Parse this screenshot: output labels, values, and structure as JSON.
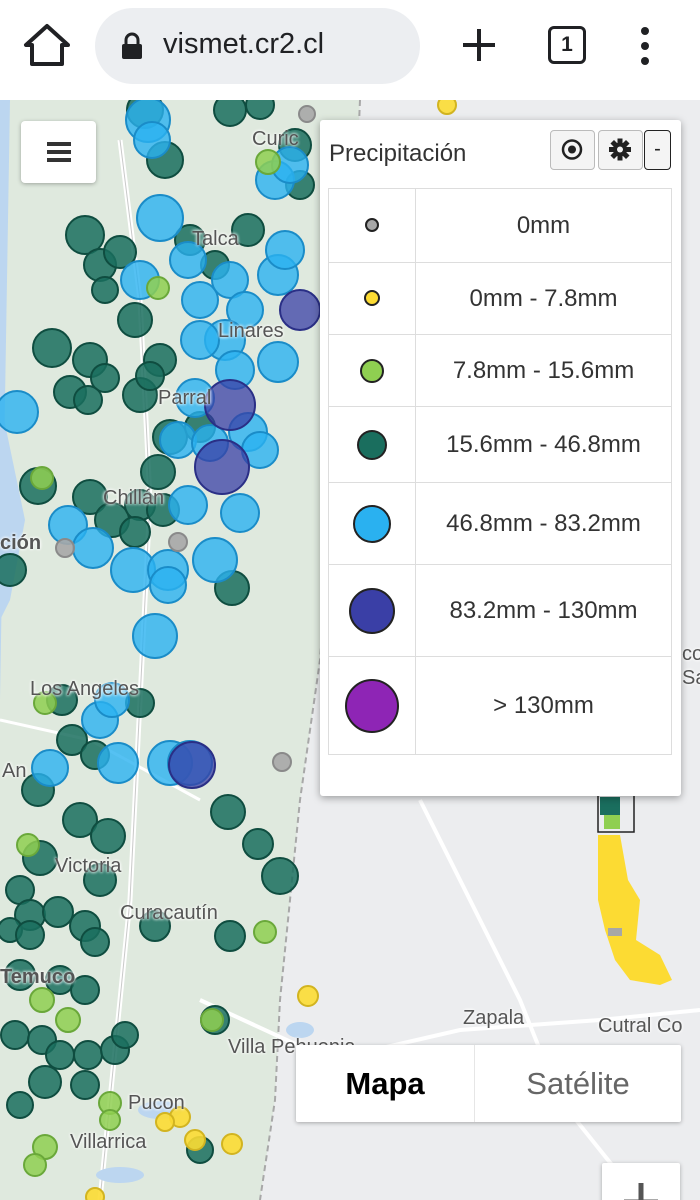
{
  "browser": {
    "url": "vismet.cr2.cl",
    "tab_count": "1"
  },
  "map": {
    "place_labels": [
      {
        "id": "curico",
        "text": "Curic"
      },
      {
        "id": "talca",
        "text": "Talca"
      },
      {
        "id": "linares",
        "text": "Linares"
      },
      {
        "id": "parral",
        "text": "Parral"
      },
      {
        "id": "chillan",
        "text": "Chillán"
      },
      {
        "id": "concepcion",
        "text": "ción"
      },
      {
        "id": "los-angeles",
        "text": "Los Angeles"
      },
      {
        "id": "angol",
        "text": "An"
      },
      {
        "id": "victoria",
        "text": "Victoria"
      },
      {
        "id": "curacautin",
        "text": "Curacautín"
      },
      {
        "id": "temuco",
        "text": "Temuco"
      },
      {
        "id": "villa-pehuenia",
        "text": "Villa Pehuenia"
      },
      {
        "id": "pucon",
        "text": "Pucon"
      },
      {
        "id": "villarrica",
        "text": "Villarrica"
      },
      {
        "id": "zapala",
        "text": "Zapala"
      },
      {
        "id": "cutral-co",
        "text": "Cutral Co"
      },
      {
        "id": "right-edge-1",
        "text": "co"
      },
      {
        "id": "right-edge-2",
        "text": "Sa"
      }
    ]
  },
  "legend": {
    "title": "Precipitación",
    "buttons": {
      "locate_icon": "target-icon",
      "settings_icon": "gear-icon",
      "collapse_label": "-"
    },
    "rows": [
      {
        "label": "0mm",
        "color": "#a7a7a7"
      },
      {
        "label": "0mm - 7.8mm",
        "color": "#fcdb33"
      },
      {
        "label": "7.8mm - 15.6mm",
        "color": "#8fcf51"
      },
      {
        "label": "15.6mm - 46.8mm",
        "color": "#1a6e5e"
      },
      {
        "label": "46.8mm - 83.2mm",
        "color": "#2ab1f0"
      },
      {
        "label": "83.2mm - 130mm",
        "color": "#3a3fa6"
      },
      {
        "label": "> 130mm",
        "color": "#8e25b5"
      }
    ]
  },
  "map_type": {
    "map_label": "Mapa",
    "satellite_label": "Satélite",
    "selected": "Mapa"
  },
  "controls": {
    "menu_icon": "hamburger-icon",
    "zoom_icon": "plus-icon"
  }
}
